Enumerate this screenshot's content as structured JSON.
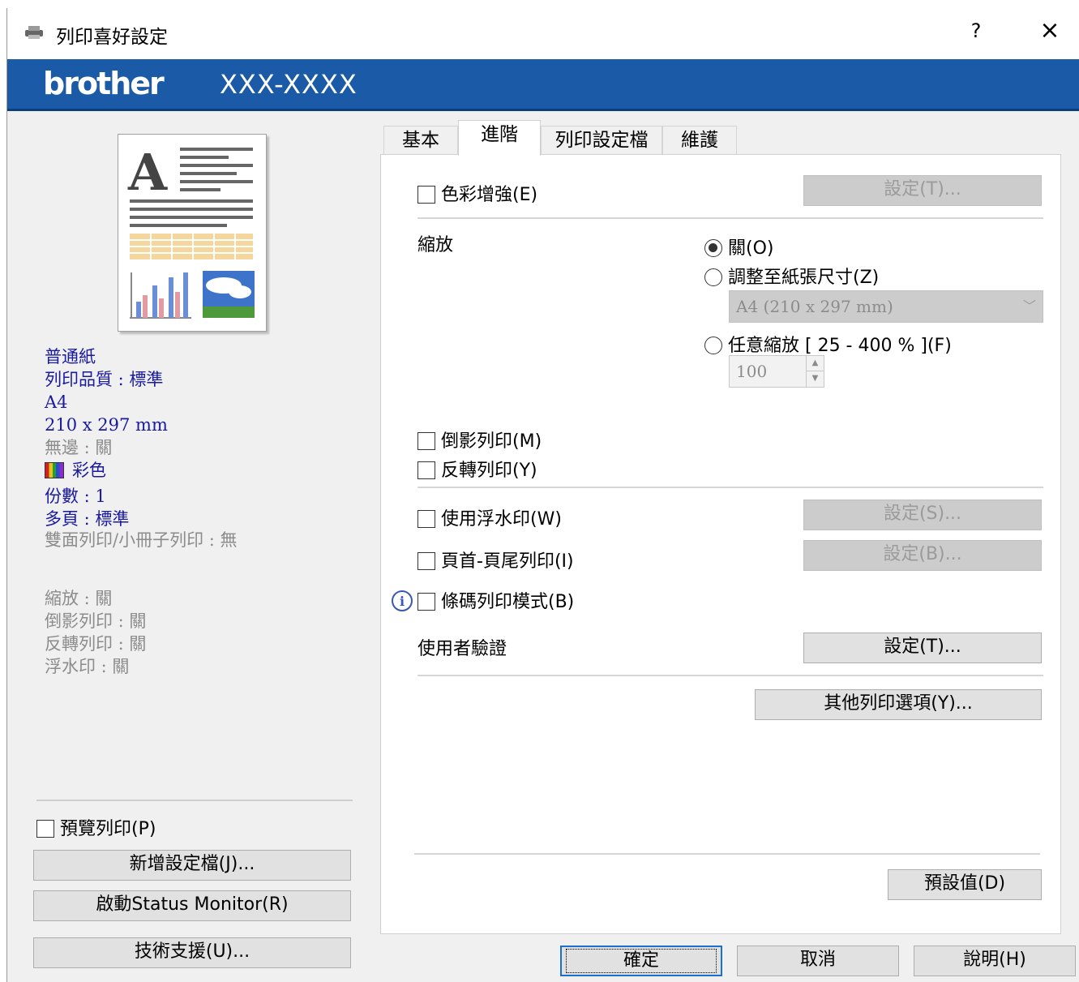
{
  "window": {
    "title": "列印喜好設定",
    "help": "?",
    "close": "×"
  },
  "brand": {
    "logo": "brother",
    "model": "XXX-XXXX"
  },
  "left": {
    "info_blue": [
      "普通紙",
      "列印品質 : 標準",
      "A4",
      "210 x 297 mm"
    ],
    "borderless": "無邊 : 關",
    "color": "彩色",
    "info_blue2": [
      "份數 : 1",
      "多頁 : 標準"
    ],
    "duplex": "雙面列印/小冊子列印 : 無",
    "info_gray": [
      "縮放 : 關",
      "倒影列印 : 關",
      "反轉列印 : 關",
      "浮水印 : 關"
    ],
    "print_preview": "預覽列印(P)",
    "buttons": {
      "add_profile": "新增設定檔(J)...",
      "status_monitor": "啟動Status Monitor(R)",
      "support": "技術支援(U)..."
    }
  },
  "tabs": [
    {
      "label": "基本",
      "active": false
    },
    {
      "label": "進階",
      "active": true
    },
    {
      "label": "列印設定檔",
      "active": false
    },
    {
      "label": "維護",
      "active": false
    }
  ],
  "advanced": {
    "color_enhance": "色彩增強(E)",
    "color_enhance_settings": "設定(T)...",
    "scaling_label": "縮放",
    "scaling_off": "關(O)",
    "scaling_fit": "調整至紙張尺寸(Z)",
    "paper_size": "A4 (210 x 297 mm)",
    "scaling_free": "任意縮放 [ 25 - 400 % ](F)",
    "scaling_value": "100",
    "mirror": "倒影列印(M)",
    "reverse": "反轉列印(Y)",
    "watermark": "使用浮水印(W)",
    "watermark_settings": "設定(S)...",
    "header_footer": "頁首-頁尾列印(I)",
    "header_footer_settings": "設定(B)...",
    "barcode": "條碼列印模式(B)",
    "user_auth": "使用者驗證",
    "user_auth_settings": "設定(T)...",
    "other_options": "其他列印選項(Y)...",
    "defaults": "預設值(D)"
  },
  "footer": {
    "ok": "確定",
    "cancel": "取消",
    "help": "說明(H)"
  },
  "colors": {
    "brand_blue": "#1b5aa6",
    "info_blue": "#1a1aa0"
  }
}
